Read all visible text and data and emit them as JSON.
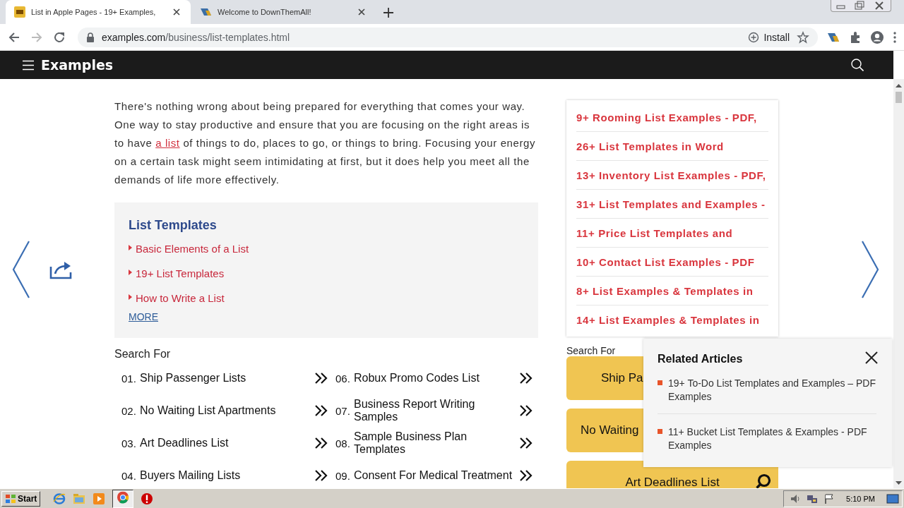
{
  "browser": {
    "tabs": [
      {
        "title": "List in Apple Pages - 19+ Examples,",
        "selected": true
      },
      {
        "title": "Welcome to DownThemAll!",
        "selected": false
      }
    ],
    "address": {
      "domain": "examples.com",
      "path": "/business/list-templates.html"
    },
    "install": "Install"
  },
  "site": {
    "logo": "Examples"
  },
  "article": {
    "before": "There's nothing wrong about being prepared for everything that comes your way. One way to stay productive and ensure that you are focusing on the right areas is to have ",
    "link": "a list",
    "after": " of things to do, places to go, or things to bring. Focusing your energy on a certain task might seem intimidating at first, but it does help you meet all the demands of life more effectively."
  },
  "toc": {
    "title": "List Templates",
    "items": [
      "Basic Elements of a List",
      "19+ List Templates",
      "How to Write a List"
    ],
    "more": "MORE"
  },
  "search_for": {
    "label": "Search For",
    "items": [
      {
        "number": "01.",
        "text": "Ship Passenger Lists"
      },
      {
        "number": "02.",
        "text": "No Waiting List Apartments"
      },
      {
        "number": "03.",
        "text": "Art Deadlines List"
      },
      {
        "number": "04.",
        "text": "Buyers Mailing Lists"
      },
      {
        "number": "06.",
        "text": "Robux Promo Codes List"
      },
      {
        "number": "07.",
        "text": "Business Report Writing Samples"
      },
      {
        "number": "08.",
        "text": "Sample Business Plan Templates"
      },
      {
        "number": "09.",
        "text": "Consent For Medical Treatment"
      }
    ]
  },
  "sidebar": {
    "links": [
      "9+ Rooming List Examples - PDF,",
      "26+ List Templates in Word",
      "13+ Inventory List Examples - PDF,",
      "31+ List Templates and Examples -",
      "11+ Price List Templates and",
      "10+ Contact List Examples - PDF",
      "8+ List Examples & Templates in",
      "14+ List Examples & Templates in"
    ],
    "search_label": "Search For",
    "buttons": [
      {
        "label": "Ship Pa",
        "search_icon": false
      },
      {
        "label": "No Waiting",
        "search_icon": false
      },
      {
        "label": "Art Deadlines List",
        "search_icon": true
      }
    ]
  },
  "related": {
    "title": "Related Articles",
    "items": [
      "19+ To-Do List Templates and Examples – PDF Examples",
      "11+ Bucket List Templates & Examples - PDF Examples"
    ]
  },
  "taskbar": {
    "start": "Start",
    "time": "5:10 PM"
  }
}
